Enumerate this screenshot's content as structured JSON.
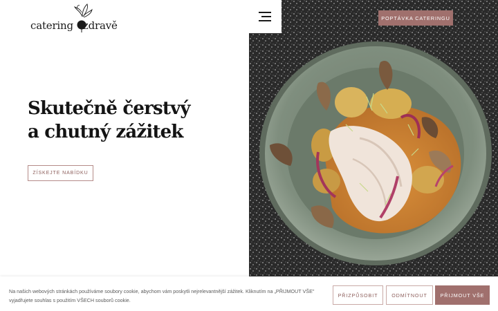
{
  "header": {
    "logo": {
      "word1": "catering",
      "word2": "zdravě"
    },
    "cta_label": "POPTÁVKA CATERINGU"
  },
  "hero": {
    "headline_line1": "Skutečně čerstvý",
    "headline_line2": "a chutný zážitek",
    "button_label": "ZÍSKEJTE NABÍDKU"
  },
  "cookie": {
    "text": "Na našich webových stránkách používáme soubory cookie, abychom vám poskytli nejrelevantnější zážitek. Kliknutím na „PŘIJMOUT VŠE\" vyjadřujete souhlas s použitím VŠECH souborů cookie.",
    "customize_label": "PŘIZPŮSOBIT",
    "decline_label": "ODMÍTNOUT",
    "accept_label": "PŘIJMOUT VŠE"
  },
  "colors": {
    "accent": "#a0706d",
    "accent_border": "#b48b88",
    "plate": "#7f8e7e",
    "background": "#ffffff"
  },
  "icons": {
    "logo_mark": "beet-icon",
    "menu": "hamburger-menu-icon"
  }
}
